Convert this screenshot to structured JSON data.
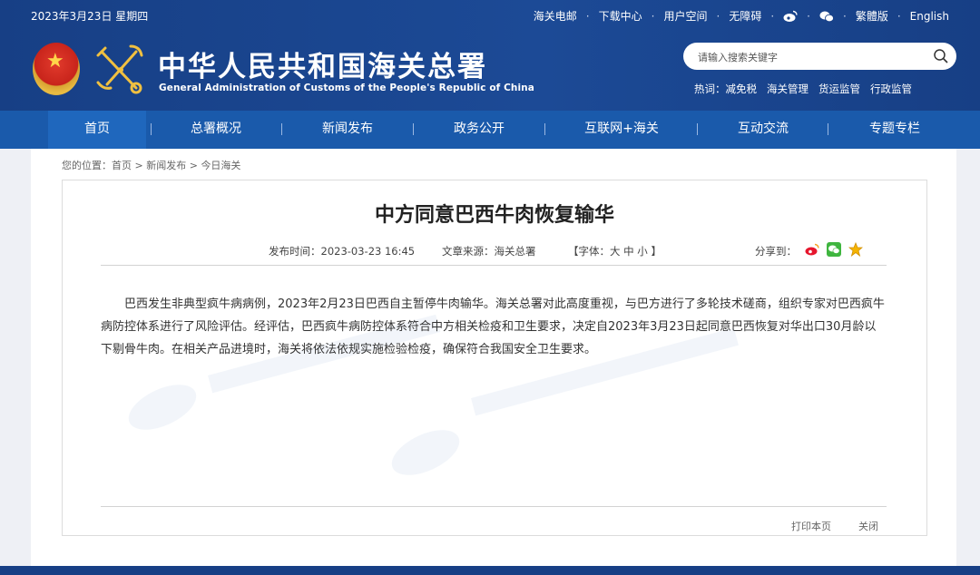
{
  "top": {
    "date": "2023年3月23日 星期四",
    "links": [
      "海关电邮",
      "下载中心",
      "用户空间",
      "无障碍",
      "繁體版",
      "English"
    ]
  },
  "site": {
    "title": "中华人民共和国海关总署",
    "subtitle": "General Administration of Customs of the People's Republic of China"
  },
  "search": {
    "placeholder": "请输入搜索关键字"
  },
  "hot": {
    "label": "热词：",
    "items": [
      "减免税",
      "海关管理",
      "货运监管",
      "行政监管"
    ]
  },
  "nav": [
    "首页",
    "总署概况",
    "新闻发布",
    "政务公开",
    "互联网+海关",
    "互动交流",
    "专题专栏"
  ],
  "breadcrumb": {
    "prefix": "您的位置：",
    "items": [
      "首页",
      "新闻发布",
      "今日海关"
    ],
    "sep": ">"
  },
  "article": {
    "title": "中方同意巴西牛肉恢复输华",
    "publish_time": "发布时间：2023-03-23 16:45",
    "source": "文章来源：海关总署",
    "font_size": "【字体：大 中 小 】",
    "share_label": "分享到：",
    "body": "巴西发生非典型疯牛病病例，2023年2月23日巴西自主暂停牛肉输华。海关总署对此高度重视，与巴方进行了多轮技术磋商，组织专家对巴西疯牛病防控体系进行了风险评估。经评估，巴西疯牛病防控体系符合中方相关检疫和卫生要求，决定自2023年3月23日起同意巴西恢复对华出口30月龄以下剔骨牛肉。在相关产品进境时，海关将依法依规实施检验检疫，确保符合我国安全卫生要求。",
    "print_label": "打印本页",
    "close_label": "关闭"
  },
  "colors": {
    "header": "#173f85",
    "nav": "#1a5aab",
    "accent": "#5aa9f0"
  }
}
